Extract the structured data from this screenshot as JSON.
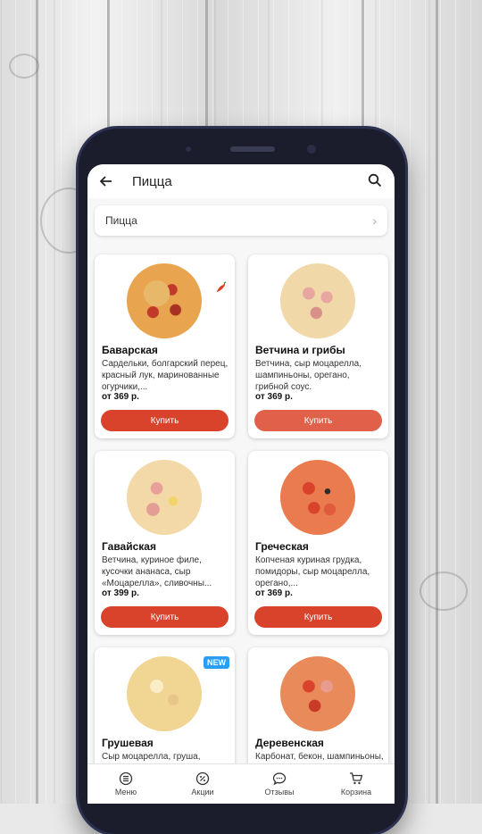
{
  "header": {
    "title": "Пицца"
  },
  "category_selector": {
    "value": "Пицца"
  },
  "products": [
    {
      "name": "Баварская",
      "description": "Сардельки, болгарский перец, красный лук, маринованные огурчики,...",
      "price": "от 369 р.",
      "button": "Купить",
      "spicy": true
    },
    {
      "name": "Ветчина и грибы",
      "description": "Ветчина, сыр моцарелла, шампиньоны, орегано, грибной соус.",
      "price": "от 369 р.",
      "button": "Купить"
    },
    {
      "name": "Гавайская",
      "description": "Ветчина, куриное филе, кусочки ананаса, сыр «Моцарелла», сливочны...",
      "price": "от 399 р.",
      "button": "Купить"
    },
    {
      "name": "Греческая",
      "description": "Копченая куриная грудка, помидоры, сыр моцарелла, орегано,...",
      "price": "от 369 р.",
      "button": "Купить"
    },
    {
      "name": "Грушевая",
      "description": "Сыр моцарелла, груша, грецкие орехи, сливочный",
      "badge": "NEW"
    },
    {
      "name": "Деревенская",
      "description": "Карбонат, бекон, шампиньоны, сыр",
      "price": "",
      "button": ""
    }
  ],
  "tabbar": [
    {
      "label": "Меню",
      "icon": "menu-icon"
    },
    {
      "label": "Акции",
      "icon": "percent-icon"
    },
    {
      "label": "Отзывы",
      "icon": "chat-icon"
    },
    {
      "label": "Корзина",
      "icon": "cart-icon"
    }
  ],
  "colors": {
    "accent": "#d9432b",
    "badge": "#2a9df4"
  }
}
